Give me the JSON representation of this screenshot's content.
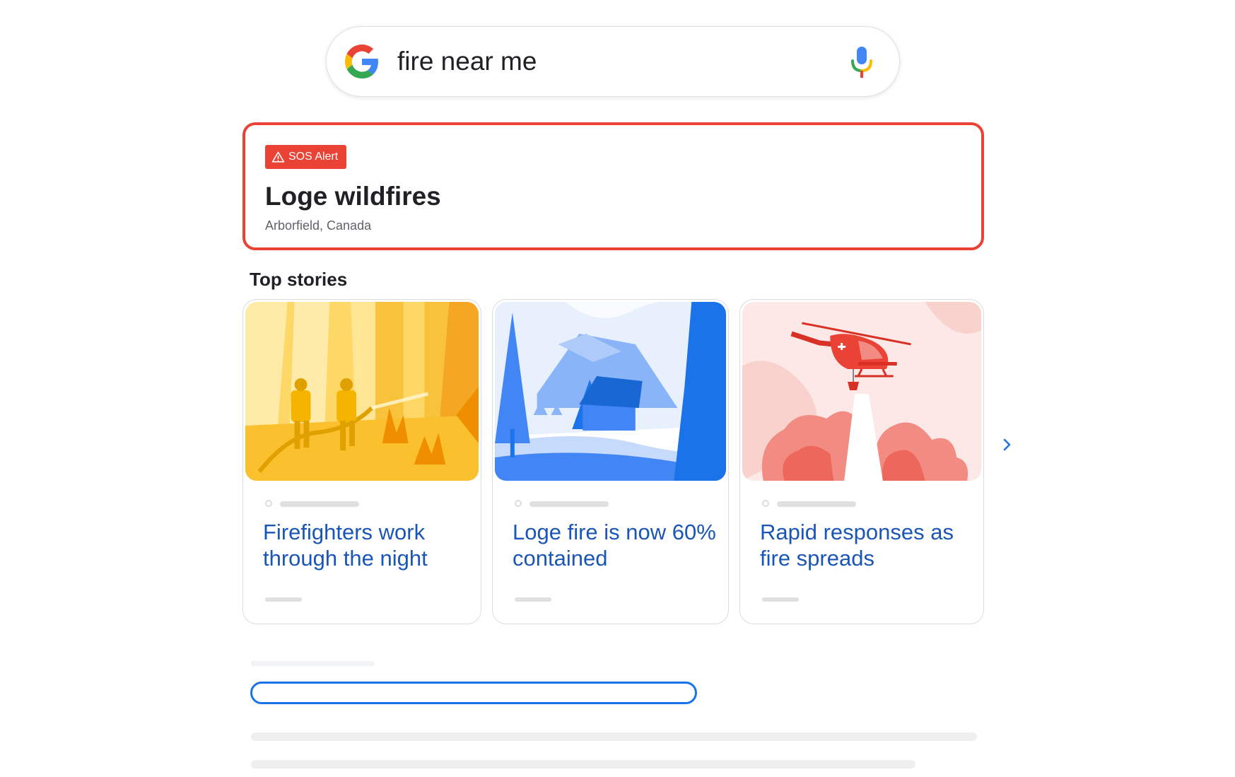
{
  "search": {
    "query": "fire near me",
    "logo_icon": "google-g-icon",
    "mic_icon": "microphone-icon"
  },
  "alert": {
    "badge": "SOS Alert",
    "badge_icon": "warning-triangle-icon",
    "title": "Loge wildfires",
    "location": "Arborfield, Canada",
    "accent_color": "#ea4335"
  },
  "top_stories": {
    "heading": "Top stories",
    "link_color": "#1a56b8",
    "items": [
      {
        "title": "Firefighters work through the night",
        "image": "firefighters-illustration",
        "theme_color": "#fbc02d"
      },
      {
        "title": "Loge fire is now 60% contained",
        "image": "cabin-forest-illustration",
        "theme_color": "#1a73e8"
      },
      {
        "title": "Rapid responses as fire spreads",
        "image": "helicopter-illustration",
        "theme_color": "#ea4335"
      }
    ],
    "next_icon": "chevron-right-icon"
  },
  "highlight_color": "#1a73e8"
}
